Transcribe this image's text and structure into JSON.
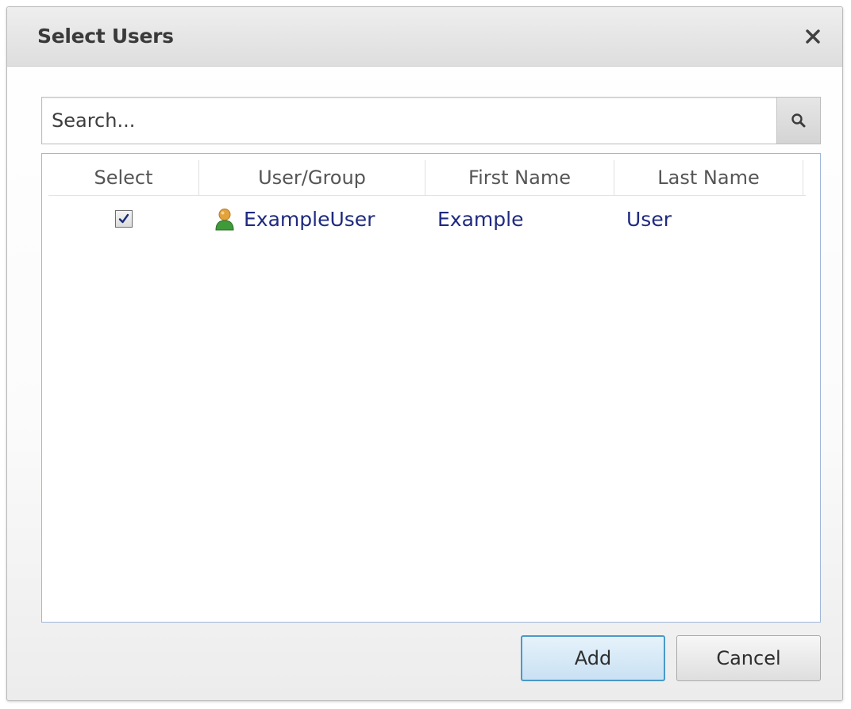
{
  "dialog": {
    "title": "Select Users",
    "close_icon": "close-icon"
  },
  "search": {
    "placeholder": "Search...",
    "value": "",
    "icon": "search-icon"
  },
  "grid": {
    "columns": [
      "Select",
      "User/Group",
      "First Name",
      "Last Name"
    ],
    "rows": [
      {
        "selected": true,
        "icon": "user-icon",
        "user_group": "ExampleUser",
        "first_name": "Example",
        "last_name": "User"
      }
    ]
  },
  "buttons": {
    "add_label": "Add",
    "cancel_label": "Cancel"
  },
  "colors": {
    "row_text": "#1f2a80",
    "grid_border": "#9fb7d9",
    "add_button_border": "#4a9ac7",
    "user_icon_head": "#e3a23a",
    "user_icon_body": "#3f9a3a"
  }
}
